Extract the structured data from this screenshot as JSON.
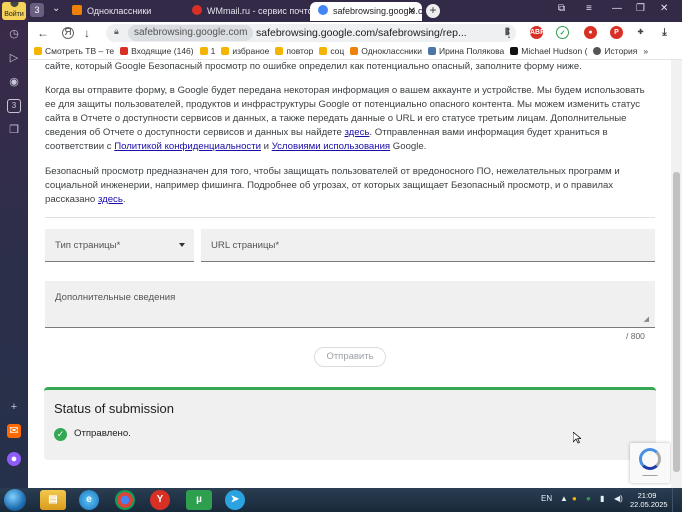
{
  "browser": {
    "rail": {
      "enter_label": "Войти",
      "badge": "3"
    },
    "tabs": [
      {
        "title": "Одноклассники",
        "fav_color": "#ee8208"
      },
      {
        "title": "WMmail.ru - сервис почто",
        "fav_color": "#d93025"
      },
      {
        "title": "safebrowsing.google.co",
        "fav_color": "#4285f4",
        "active": true
      }
    ],
    "tab_counter": "3",
    "address": {
      "host": "safebrowsing.google.com",
      "url": "safebrowsing.google.com/safebrowsing/rep..."
    },
    "bookmarks": [
      {
        "label": "Смотреть ТВ – те",
        "color": "#f4b400"
      },
      {
        "label": "Входящие (146)",
        "color": "#d93025"
      },
      {
        "label": "1",
        "color": "#f4b400"
      },
      {
        "label": "избраное",
        "color": "#f4b400"
      },
      {
        "label": "повтор",
        "color": "#f4b400"
      },
      {
        "label": "соц",
        "color": "#f4b400"
      },
      {
        "label": "Одноклассники",
        "color": "#ee8208"
      },
      {
        "label": "Ирина Полякова",
        "color": "#4a76a8"
      },
      {
        "label": "Michael Hudson (",
        "color": "#111111"
      },
      {
        "label": "История",
        "color": "#555555"
      }
    ]
  },
  "page": {
    "intro_tail": "сайте, который Google Безопасный просмотр по ошибке определил как потенциально опасный, заполните форму ниже.",
    "para1_a": "Когда вы отправите форму, в Google будет передана некоторая информация о вашем аккаунте и устройстве. Мы будем использовать ее для защиты пользователей, продуктов и инфраструктуры Google от потенциально опасного контента. Мы можем изменить статус сайта в Отчете о доступности сервисов и данных, а также передать данные о URL и его статусе третьим лицам. Дополнительные сведения об Отчете о доступности сервисов и данных вы найдете ",
    "para1_link": "здесь",
    "para1_b": ". Отправленная вами информация будет храниться в соответствии с ",
    "privacy_link": "Политикой конфиденциальности",
    "and": " и ",
    "terms_link": "Условиями использования",
    "para1_c": " Google.",
    "para2_a": "Безопасный просмотр предназначен для того, чтобы защищать пользователей от вредоносного ПО, нежелательных программ и социальной инженерии, например фишинга. Подробнее об угрозах, от которых защищает Безопасный просмотр, и о правилах рассказано ",
    "para2_link": "здесь",
    "para2_b": ".",
    "form": {
      "page_type_label": "Тип страницы*",
      "url_label": "URL страницы*",
      "details_label": "Дополнительные сведения",
      "char_count": "/ 800",
      "submit_label": "Отправить"
    },
    "status": {
      "title": "Status of submission",
      "message": "Отправлено."
    }
  },
  "taskbar": {
    "lang": "EN",
    "time": "21:09",
    "date": "22.05.2025"
  }
}
